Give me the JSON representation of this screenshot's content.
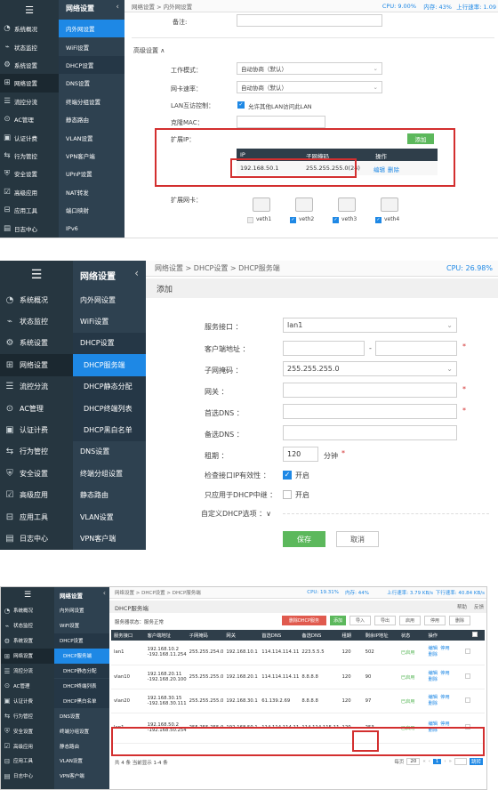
{
  "shot1": {
    "sidebar_toggle": "☰",
    "nav": [
      {
        "label": "系统概况",
        "icon": "dashboard-icon"
      },
      {
        "label": "状态监控",
        "icon": "monitor-icon"
      },
      {
        "label": "系统设置",
        "icon": "gear-icon"
      },
      {
        "label": "网络设置",
        "icon": "network-icon"
      },
      {
        "label": "流控分流",
        "icon": "flow-icon"
      },
      {
        "label": "AC管理",
        "icon": "ac-icon"
      },
      {
        "label": "认证计费",
        "icon": "auth-icon"
      },
      {
        "label": "行为管控",
        "icon": "behavior-icon"
      },
      {
        "label": "安全设置",
        "icon": "shield-icon"
      },
      {
        "label": "高级应用",
        "icon": "advanced-icon"
      },
      {
        "label": "应用工具",
        "icon": "tools-icon"
      },
      {
        "label": "日志中心",
        "icon": "log-icon"
      }
    ],
    "sub_title": "网络设置",
    "sub": [
      "内外网设置",
      "WiFi设置",
      "DHCP设置",
      "DNS设置",
      "终端分组设置",
      "静态路由",
      "VLAN设置",
      "VPN客户端",
      "UPnP设置",
      "NAT转发",
      "端口映射",
      "IPv6"
    ],
    "breadcrumb": "网络设置 > 内外网设置",
    "status": {
      "cpu": "CPU: 9.00%",
      "mem": "内存: 43%",
      "up": "上行速率: 1.09"
    },
    "remark_label": "备注:",
    "advanced_label": "高级设置 ∧",
    "form": [
      {
        "label": "工作模式：",
        "value": "自动协商（默认）"
      },
      {
        "label": "网卡速率：",
        "value": "自动协商（默认）"
      }
    ],
    "lan_label": "LAN互访控制：",
    "lan_value": "允许其他LAN访问此LAN",
    "mac_label": "克隆MAC：",
    "ext_ip_label": "扩展IP：",
    "add_btn": "添加",
    "table_headers": [
      "IP",
      "子网掩码",
      "操作"
    ],
    "row": {
      "ip": "192.168.50.1",
      "mask": "255.255.255.0(24)",
      "edit": "编辑",
      "del": "删除"
    },
    "ext_nic_label": "扩展网卡：",
    "nics": [
      "veth1",
      "veth2",
      "veth3",
      "veth4"
    ],
    "colors": {
      "accent": "#1e88e5",
      "green": "#5cb85c",
      "red": "#d32f2f"
    }
  },
  "shot2": {
    "sidebar_toggle": "☰",
    "nav": [
      {
        "label": "系统概况",
        "icon": "dashboard-icon"
      },
      {
        "label": "状态监控",
        "icon": "monitor-icon"
      },
      {
        "label": "系统设置",
        "icon": "gear-icon"
      },
      {
        "label": "网络设置",
        "icon": "network-icon"
      },
      {
        "label": "流控分流",
        "icon": "flow-icon"
      },
      {
        "label": "AC管理",
        "icon": "ac-icon"
      },
      {
        "label": "认证计费",
        "icon": "auth-icon"
      },
      {
        "label": "行为管控",
        "icon": "behavior-icon"
      },
      {
        "label": "安全设置",
        "icon": "shield-icon"
      },
      {
        "label": "高级应用",
        "icon": "advanced-icon"
      },
      {
        "label": "应用工具",
        "icon": "tools-icon"
      },
      {
        "label": "日志中心",
        "icon": "log-icon"
      }
    ],
    "sub_title": "网络设置",
    "sub": [
      "内外网设置",
      "WiFi设置",
      "DHCP设置",
      "DHCP服务端",
      "DHCP静态分配",
      "DHCP终端列表",
      "DHCP黑白名单",
      "DNS设置",
      "终端分组设置",
      "静态路由",
      "VLAN设置",
      "VPN客户端"
    ],
    "breadcrumb": "网络设置 > DHCP设置 > DHCP服务端",
    "cpu": "CPU: 26.98%",
    "page_title": "添加",
    "fields": {
      "service_if": "服务接口 ：",
      "service_if_value": "lan1",
      "pool": "客户端地址 ：",
      "pool_sep": "-",
      "mask": "子网掩码 ：",
      "mask_value": "255.255.255.0",
      "gateway": "网关 ：",
      "dns1": "首选DNS ：",
      "dns2": "备选DNS ：",
      "lease": "租期 ：",
      "lease_value": "120",
      "lease_unit": "分钟",
      "check_if": "检查接口IP有效性 ：",
      "check_if_value": "开启",
      "relay_only": "只应用于DHCP中继 ：",
      "relay_only_value": "开启",
      "custom": "自定义DHCP选项 ：∨"
    },
    "save": "保存",
    "cancel": "取消"
  },
  "shot3": {
    "breadcrumb": "网络设置 > DHCP设置 > DHCP服务端",
    "status": {
      "cpu": "CPU: 19.31%",
      "mem": "内存: 44%",
      "up": "上行速率: 3.79 KB/s",
      "down": "下行速率: 40.84 KB/s"
    },
    "title": "DHCP服务端",
    "help": "帮助",
    "feedback": "反馈",
    "service_status": "服务器状态：服务正常",
    "toolbar": [
      "删除DHCP服务",
      "添加",
      "导入",
      "导出",
      "启用",
      "停用",
      "删除"
    ],
    "headers": [
      "服务接口",
      "客户端地址",
      "子网掩码",
      "网关",
      "首选DNS",
      "备选DNS",
      "租期",
      "剩余IP地址",
      "状态",
      "操作"
    ],
    "rows": [
      {
        "if": "lan1",
        "pool": "192.168.10.2\n-192.168.11.254",
        "mask": "255.255.254.0",
        "gw": "192.168.10.1",
        "dns1": "114.114.114.11",
        "dns2": "223.5.5.5",
        "lease": "120",
        "left": "502",
        "status": "已启用"
      },
      {
        "if": "vlan10",
        "pool": "192.168.20.11\n-192.168.20.100",
        "mask": "255.255.255.0",
        "gw": "192.168.20.1",
        "dns1": "114.114.114.11",
        "dns2": "8.8.8.8",
        "lease": "120",
        "left": "90",
        "status": "已启用"
      },
      {
        "if": "vlan20",
        "pool": "192.168.30.15\n-192.168.30.111",
        "mask": "255.255.255.0",
        "gw": "192.168.30.1",
        "dns1": "61.139.2.69",
        "dns2": "8.8.8.8",
        "lease": "120",
        "left": "97",
        "status": "已启用"
      },
      {
        "if": "lan1",
        "pool": "192.168.50.2\n-192.168.50.254",
        "mask": "255.255.255.0",
        "gw": "192.168.50.1",
        "dns1": "114.114.114.11",
        "dns2": "114.114.115.11",
        "lease": "120",
        "left": "253",
        "status": "已启用"
      }
    ],
    "ops": {
      "edit": "编辑",
      "disable": "停用",
      "del": "删除"
    },
    "footer": "共 4 条 当前显示 1-4 条",
    "page_size": "20",
    "current_page": "1",
    "jump": "跳转"
  }
}
